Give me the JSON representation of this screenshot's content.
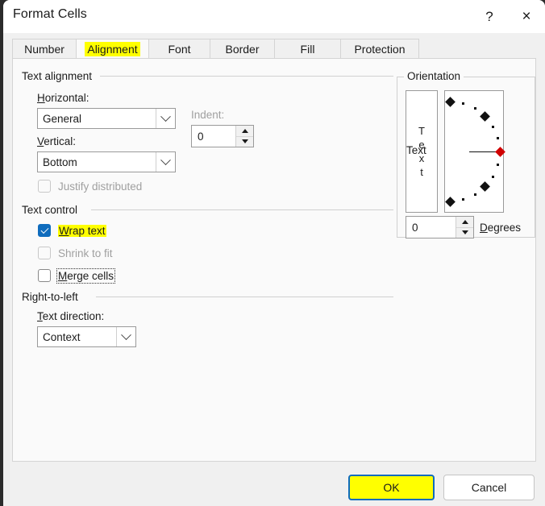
{
  "window": {
    "title": "Format Cells",
    "help_icon": "?",
    "close_icon": "×"
  },
  "tabs": [
    {
      "label": "Number",
      "selected": false,
      "highlighted": false
    },
    {
      "label": "Alignment",
      "selected": true,
      "highlighted": true
    },
    {
      "label": "Font",
      "selected": false,
      "highlighted": false
    },
    {
      "label": "Border",
      "selected": false,
      "highlighted": false
    },
    {
      "label": "Fill",
      "selected": false,
      "highlighted": false
    },
    {
      "label": "Protection",
      "selected": false,
      "highlighted": false
    }
  ],
  "text_alignment": {
    "group_label": "Text alignment",
    "horizontal_label": "Horizontal:",
    "horizontal_accel": "H",
    "horizontal_value": "General",
    "vertical_label": "Vertical:",
    "vertical_accel": "V",
    "vertical_value": "Bottom",
    "indent_label": "Indent:",
    "indent_value": "0",
    "indent_disabled": true,
    "justify_distributed_label": "Justify distributed",
    "justify_distributed_checked": false,
    "justify_distributed_disabled": true
  },
  "text_control": {
    "group_label": "Text control",
    "items": [
      {
        "label": "Wrap text",
        "accel": "W",
        "checked": true,
        "disabled": false,
        "highlighted": true,
        "focused": false
      },
      {
        "label": "Shrink to fit",
        "accel": "",
        "checked": false,
        "disabled": true,
        "highlighted": false,
        "focused": false
      },
      {
        "label": "Merge cells",
        "accel": "M",
        "checked": false,
        "disabled": false,
        "highlighted": false,
        "focused": true
      }
    ]
  },
  "right_to_left": {
    "group_label": "Right-to-left",
    "text_direction_label": "Text direction:",
    "text_direction_accel": "T",
    "text_direction_value": "Context"
  },
  "orientation": {
    "group_label": "Orientation",
    "vertical_text_letters": [
      "T",
      "e",
      "x",
      "t"
    ],
    "dial_text": "Text",
    "degrees_value": "0",
    "degrees_label": "Degrees",
    "degrees_accel": "D",
    "handle_angle_degrees": 0,
    "marker_color": "#111111",
    "handle_color": "#d00000"
  },
  "footer": {
    "ok_label": "OK",
    "cancel_label": "Cancel",
    "ok_focused": true,
    "ok_highlight_color": "#ffff00",
    "focus_border_color": "#0f6cbd"
  },
  "theme": {
    "dialog_bg": "#f0f0f0",
    "panel_bg": "#fafafa",
    "titlebar_bg": "#ffffff",
    "accent": "#0f6cbd",
    "highlight": "#ffff00",
    "text": "#1b1b1b",
    "disabled_text": "#a0a0a0"
  }
}
